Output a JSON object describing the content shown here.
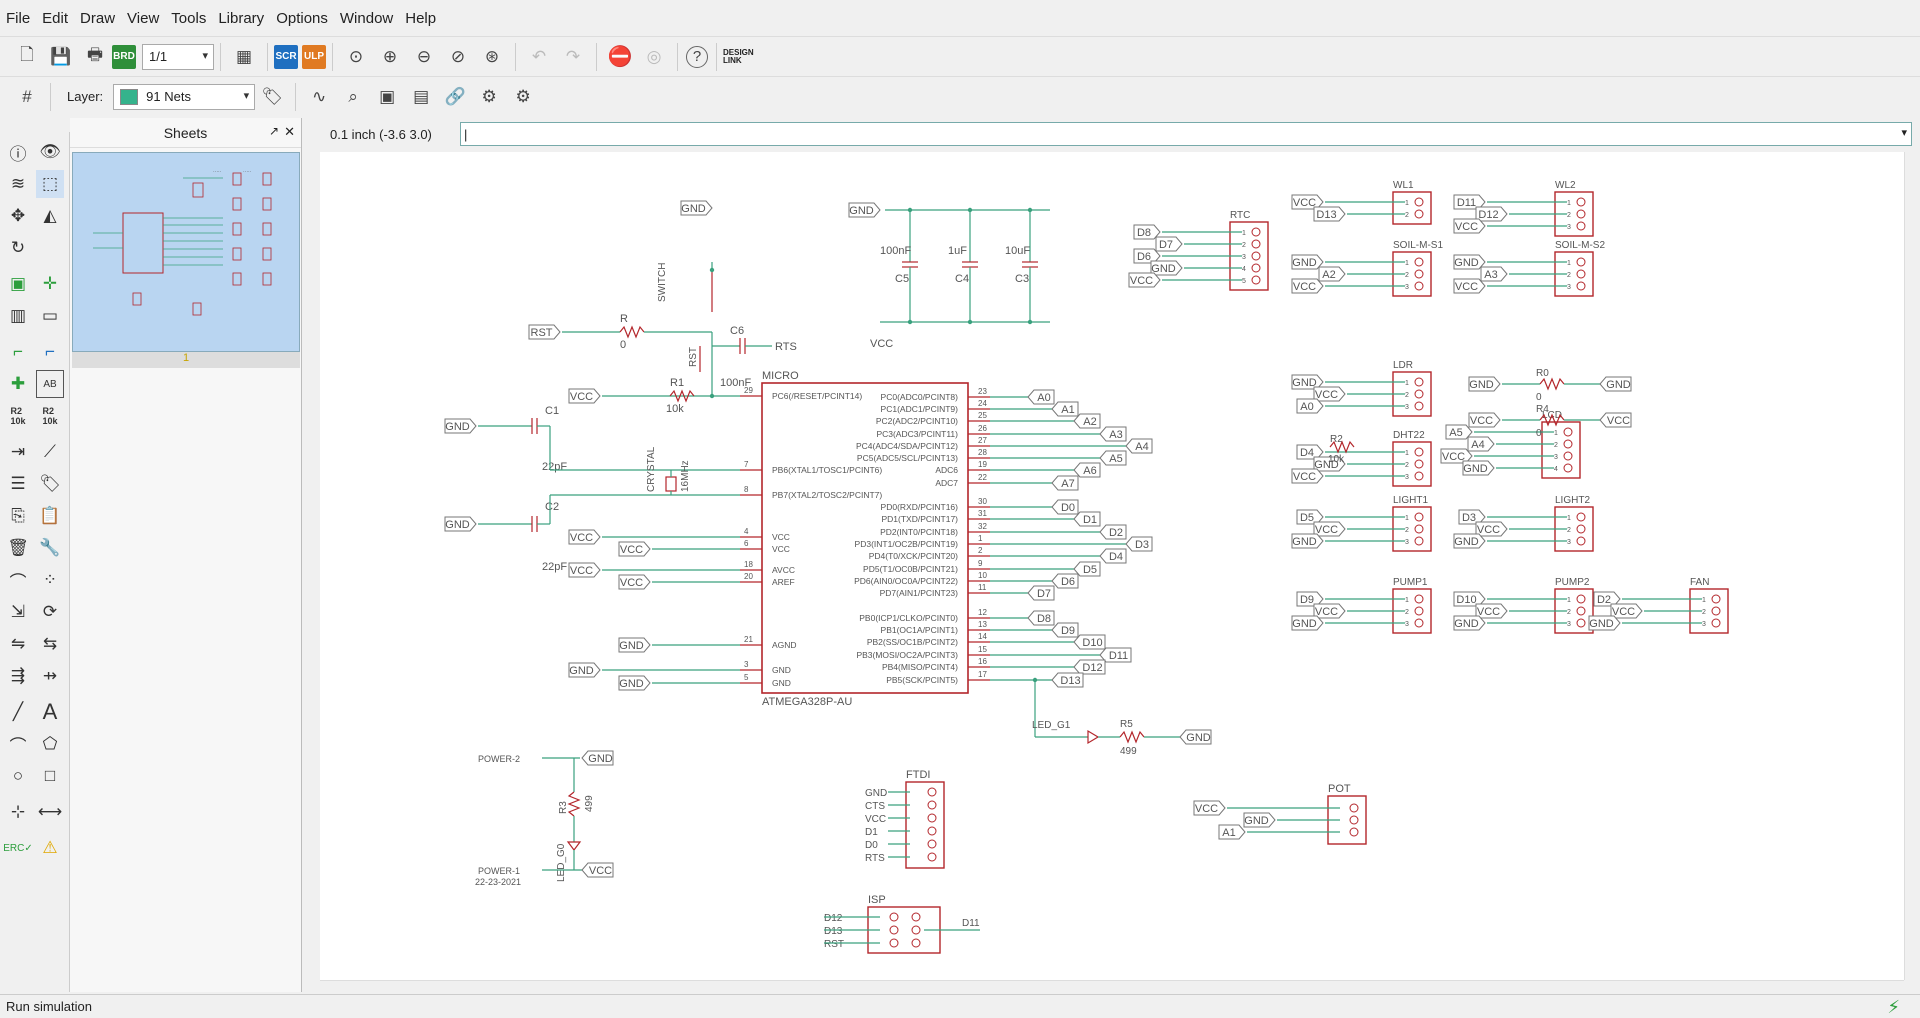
{
  "menu": [
    "File",
    "Edit",
    "Draw",
    "View",
    "Tools",
    "Library",
    "Options",
    "Window",
    "Help"
  ],
  "toolbar": {
    "sheet_combo": "1/1",
    "scr": "SCR",
    "ulp": "ULP",
    "brd": "BRD",
    "help": "?",
    "design_link": "DESIGN LINK"
  },
  "layer": {
    "label": "Layer:",
    "value": "91 Nets",
    "color": "#35b38c"
  },
  "sheets_panel": {
    "title": "Sheets",
    "sheet_number": "1"
  },
  "coord": "0.1 inch (-3.6 3.0)",
  "command": "|",
  "status": "Run simulation",
  "colors": {
    "wire": "#3aa17e",
    "symbol": "#b3262b",
    "text": "#555555",
    "thumb": "#b9d5f1"
  },
  "schematic": {
    "micro_name": "MICRO",
    "micro_value": "ATMEGA328P-AU",
    "left_pins": [
      {
        "num": "29",
        "name": "PC6(/RESET/PCINT14)"
      },
      {
        "num": "7",
        "name": "PB6(XTAL1/TOSC1/PCINT6)"
      },
      {
        "num": "8",
        "name": "PB7(XTAL2/TOSC2/PCINT7)"
      },
      {
        "num": "4",
        "name": "VCC"
      },
      {
        "num": "6",
        "name": "VCC"
      },
      {
        "num": "18",
        "name": "AVCC"
      },
      {
        "num": "20",
        "name": "AREF"
      },
      {
        "num": "21",
        "name": "AGND"
      },
      {
        "num": "3",
        "name": "GND"
      },
      {
        "num": "5",
        "name": "GND"
      }
    ],
    "right_pins": [
      {
        "num": "23",
        "name": "PC0(ADC0/PCINT8)",
        "net": "A0"
      },
      {
        "num": "24",
        "name": "PC1(ADC1/PCINT9)",
        "net": "A1"
      },
      {
        "num": "25",
        "name": "PC2(ADC2/PCINT10)",
        "net": "A2"
      },
      {
        "num": "26",
        "name": "PC3(ADC3/PCINT11)",
        "net": "A3"
      },
      {
        "num": "27",
        "name": "PC4(ADC4/SDA/PCINT12)",
        "net": "A4"
      },
      {
        "num": "28",
        "name": "PC5(ADC5/SCL/PCINT13)",
        "net": "A5"
      },
      {
        "num": "19",
        "name": "ADC6",
        "net": "A6"
      },
      {
        "num": "22",
        "name": "ADC7",
        "net": "A7"
      },
      {
        "num": "30",
        "name": "PD0(RXD/PCINT16)",
        "net": "D0"
      },
      {
        "num": "31",
        "name": "PD1(TXD/PCINT17)",
        "net": "D1"
      },
      {
        "num": "32",
        "name": "PD2(INT0/PCINT18)",
        "net": "D2"
      },
      {
        "num": "1",
        "name": "PD3(INT1/OC2B/PCINT19)",
        "net": "D3"
      },
      {
        "num": "2",
        "name": "PD4(T0/XCK/PCINT20)",
        "net": "D4"
      },
      {
        "num": "9",
        "name": "PD5(T1/OC0B/PCINT21)",
        "net": "D5"
      },
      {
        "num": "10",
        "name": "PD6(AIN0/OC0A/PCINT22)",
        "net": "D6"
      },
      {
        "num": "11",
        "name": "PD7(AIN1/PCINT23)",
        "net": "D7"
      },
      {
        "num": "12",
        "name": "PB0(ICP1/CLKO/PCINT0)",
        "net": "D8"
      },
      {
        "num": "13",
        "name": "PB1(OC1A/PCINT1)",
        "net": "D9"
      },
      {
        "num": "14",
        "name": "PB2(SS/OC1B/PCINT2)",
        "net": "D10"
      },
      {
        "num": "15",
        "name": "PB3(MOSI/OC2A/PCINT3)",
        "net": "D11"
      },
      {
        "num": "16",
        "name": "PB4(MISO/PCINT4)",
        "net": "D12"
      },
      {
        "num": "17",
        "name": "PB5(SCK/PCINT5)",
        "net": "D13"
      }
    ],
    "labels": {
      "vcc": "VCC",
      "gnd": "GND",
      "rst": "RST",
      "rts": "RTS",
      "r": "R",
      "r0val": "0",
      "r1": "R1",
      "r1val": "10k",
      "c6": "C6",
      "c6val": "100nF",
      "switch": "SWITCH",
      "c1": "C1",
      "c2": "C2",
      "c1val": "22pF",
      "c2val": "22pF",
      "crystal": "CRYSTAL",
      "crystalval": "16MHz",
      "c5val": "100nF",
      "c4val": "1uF",
      "c3val": "10uF",
      "c5": "C5",
      "c4": "C4",
      "c3": "C3",
      "led_g1": "LED_G1",
      "r5": "R5",
      "r5val": "499",
      "power2": "POWER-2",
      "power1": "POWER-1",
      "date": "22-23-2021",
      "r3": "R3",
      "r3val": "499",
      "led_g0": "LED_G0",
      "ftdi": "FTDI",
      "ftdi_pins": [
        "GND",
        "CTS",
        "VCC",
        "D1",
        "D0",
        "RTS"
      ],
      "isp": "ISP",
      "isp_left": [
        "D12",
        "D13",
        "RST"
      ],
      "isp_right": "D11",
      "pot": "POT",
      "pot_net": "A1"
    },
    "connectors": [
      {
        "name": "WL1",
        "nets": [
          "VCC",
          "D13"
        ]
      },
      {
        "name": "WL2",
        "nets": [
          "D11",
          "D12",
          "VCC"
        ]
      },
      {
        "name": "RTC",
        "nets": [
          "D8",
          "D7",
          "D6",
          "GND",
          "VCC"
        ]
      },
      {
        "name": "SOIL-M-S1",
        "nets": [
          "GND",
          "A2",
          "VCC"
        ]
      },
      {
        "name": "SOIL-M-S2",
        "nets": [
          "GND",
          "A3",
          "VCC"
        ]
      },
      {
        "name": "LDR",
        "nets": [
          "GND",
          "VCC",
          "A0"
        ]
      },
      {
        "name": "R0",
        "nets": [
          "GND",
          "GND"
        ]
      },
      {
        "name": "R4",
        "nets": [
          "VCC",
          "VCC"
        ]
      },
      {
        "name": "R2",
        "nets": [
          "GND",
          "10k"
        ]
      },
      {
        "name": "DHT22",
        "nets": [
          "D4",
          "GND",
          "VCC"
        ]
      },
      {
        "name": "LCD",
        "nets": [
          "A5",
          "A4",
          "VCC",
          "GND"
        ]
      },
      {
        "name": "LIGHT1",
        "nets": [
          "D5",
          "VCC",
          "GND"
        ]
      },
      {
        "name": "LIGHT2",
        "nets": [
          "D3",
          "VCC",
          "GND"
        ]
      },
      {
        "name": "PUMP1",
        "nets": [
          "D9",
          "VCC",
          "GND"
        ]
      },
      {
        "name": "PUMP2",
        "nets": [
          "D10",
          "VCC",
          "GND"
        ]
      },
      {
        "name": "FAN",
        "nets": [
          "D2",
          "VCC",
          "GND"
        ]
      }
    ]
  }
}
